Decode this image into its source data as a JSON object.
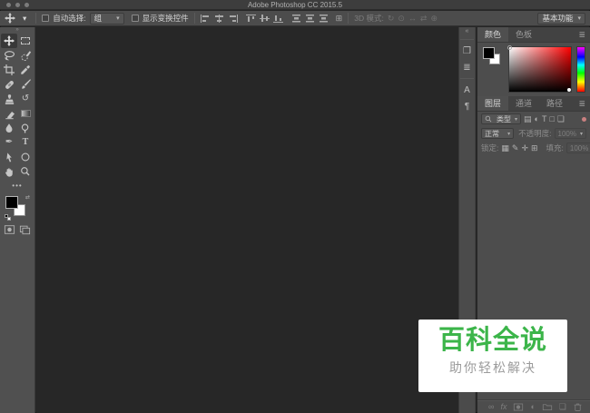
{
  "window": {
    "title": "Adobe Photoshop CC 2015.5"
  },
  "options_bar": {
    "auto_select_label": "自动选择:",
    "auto_select_value": "组",
    "show_transform_label": "显示变换控件",
    "mode_3d_label": "3D 模式:",
    "workspace": "基本功能"
  },
  "panels": {
    "color": {
      "tabs": [
        "颜色",
        "色板"
      ]
    },
    "layers": {
      "tabs": [
        "图层",
        "通道",
        "路径"
      ],
      "kind_filter_label": "类型",
      "blend_mode": "正常",
      "opacity_label": "不透明度:",
      "opacity_value": "100%",
      "lock_label": "锁定:",
      "fill_label": "填充:",
      "fill_value": "100%"
    }
  },
  "watermark": {
    "title": "百科全说",
    "subtitle": "助你轻松解决"
  },
  "icons": {
    "caret": "▾",
    "panel_menu": "≣",
    "expand_dock": "«",
    "toolbar_grip": "»",
    "ellipsis": "•••",
    "pen": "✒",
    "history_brush": "↺",
    "type": "T",
    "history_panel": "❐",
    "properties_panel": "≣",
    "character_panel": "A",
    "paragraph_panel": "¶",
    "filter_image": "▤",
    "filter_adjust": "◐",
    "filter_type": "T",
    "filter_shape": "□",
    "filter_smart": "❏",
    "lock_transparent": "▦",
    "lock_image": "✎",
    "lock_position": "✛",
    "lock_artboard": "⊞",
    "link": "∞",
    "fx": "fx",
    "adjustment": "◐",
    "new_layer": "❏",
    "grid": "⊞",
    "swap": "⇄",
    "m3d_rotate": "↻",
    "m3d_roll": "⊙",
    "m3d_drag": "↔",
    "m3d_slide": "⇄",
    "m3d_scale": "⊕"
  },
  "colors": {
    "watermark_green": "#3CB54A",
    "canvas_background": "#272727",
    "panel_background": "#4D4D4D",
    "titlebar_background": "#3D3D3D"
  }
}
